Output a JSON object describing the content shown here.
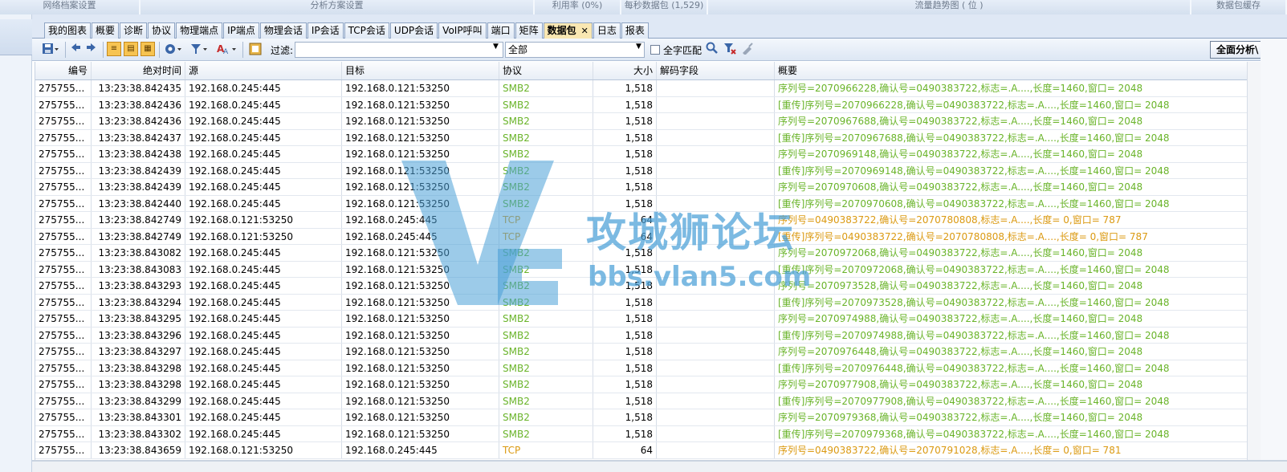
{
  "top_headers": [
    {
      "label": "网络档案设置"
    },
    {
      "label": "分析方案设置"
    },
    {
      "label": "利用率 (0%)"
    },
    {
      "label": "每秒数据包 (1,529)"
    },
    {
      "label": "流量趋势图 ( 位 )"
    },
    {
      "label": "数据包缓存"
    }
  ],
  "tabs": [
    {
      "label": "我的图表"
    },
    {
      "label": "概要"
    },
    {
      "label": "诊断"
    },
    {
      "label": "协议"
    },
    {
      "label": "物理端点"
    },
    {
      "label": "IP端点"
    },
    {
      "label": "物理会话"
    },
    {
      "label": "IP会话"
    },
    {
      "label": "TCP会话"
    },
    {
      "label": "UDP会话"
    },
    {
      "label": "VoIP呼叫"
    },
    {
      "label": "端口"
    },
    {
      "label": "矩阵"
    },
    {
      "label": "数据包",
      "active": true
    },
    {
      "label": "日志"
    },
    {
      "label": "报表"
    }
  ],
  "active_tab_close": "✕",
  "toolbar": {
    "filter_label": "过滤:",
    "filter_value": "",
    "scope_value": "全部",
    "full_match_label": "全字匹配",
    "full_match_checked": false,
    "full_analysis_label": "全面分析\\"
  },
  "table": {
    "columns": [
      "编号",
      "绝对时间",
      "源",
      "目标",
      "协议",
      "大小",
      "解码字段",
      "概要"
    ],
    "rows": [
      [
        "275755...",
        "13:23:38.842435",
        "192.168.0.245:445",
        "192.168.0.121:53250",
        "SMB2",
        "1,518",
        "",
        "序列号=2070966228,确认号=0490383722,标志=.A....,长度=1460,窗口= 2048"
      ],
      [
        "275755...",
        "13:23:38.842436",
        "192.168.0.245:445",
        "192.168.0.121:53250",
        "SMB2",
        "1,518",
        "",
        "[重传]序列号=2070966228,确认号=0490383722,标志=.A....,长度=1460,窗口= 2048"
      ],
      [
        "275755...",
        "13:23:38.842436",
        "192.168.0.245:445",
        "192.168.0.121:53250",
        "SMB2",
        "1,518",
        "",
        "序列号=2070967688,确认号=0490383722,标志=.A....,长度=1460,窗口= 2048"
      ],
      [
        "275755...",
        "13:23:38.842437",
        "192.168.0.245:445",
        "192.168.0.121:53250",
        "SMB2",
        "1,518",
        "",
        "[重传]序列号=2070967688,确认号=0490383722,标志=.A....,长度=1460,窗口= 2048"
      ],
      [
        "275755...",
        "13:23:38.842438",
        "192.168.0.245:445",
        "192.168.0.121:53250",
        "SMB2",
        "1,518",
        "",
        "序列号=2070969148,确认号=0490383722,标志=.A....,长度=1460,窗口= 2048"
      ],
      [
        "275755...",
        "13:23:38.842439",
        "192.168.0.245:445",
        "192.168.0.121:53250",
        "SMB2",
        "1,518",
        "",
        "[重传]序列号=2070969148,确认号=0490383722,标志=.A....,长度=1460,窗口= 2048"
      ],
      [
        "275755...",
        "13:23:38.842439",
        "192.168.0.245:445",
        "192.168.0.121:53250",
        "SMB2",
        "1,518",
        "",
        "序列号=2070970608,确认号=0490383722,标志=.A....,长度=1460,窗口= 2048"
      ],
      [
        "275755...",
        "13:23:38.842440",
        "192.168.0.245:445",
        "192.168.0.121:53250",
        "SMB2",
        "1,518",
        "",
        "[重传]序列号=2070970608,确认号=0490383722,标志=.A....,长度=1460,窗口= 2048"
      ],
      [
        "275755...",
        "13:23:38.842749",
        "192.168.0.121:53250",
        "192.168.0.245:445",
        "TCP",
        "64",
        "",
        "序列号=0490383722,确认号=2070780808,标志=.A....,长度=    0,窗口=  787"
      ],
      [
        "275755...",
        "13:23:38.842749",
        "192.168.0.121:53250",
        "192.168.0.245:445",
        "TCP",
        "64",
        "",
        "[重传]序列号=0490383722,确认号=2070780808,标志=.A....,长度=    0,窗口=  787"
      ],
      [
        "275755...",
        "13:23:38.843082",
        "192.168.0.245:445",
        "192.168.0.121:53250",
        "SMB2",
        "1,518",
        "",
        "序列号=2070972068,确认号=0490383722,标志=.A....,长度=1460,窗口= 2048"
      ],
      [
        "275755...",
        "13:23:38.843083",
        "192.168.0.245:445",
        "192.168.0.121:53250",
        "SMB2",
        "1,518",
        "",
        "[重传]序列号=2070972068,确认号=0490383722,标志=.A....,长度=1460,窗口= 2048"
      ],
      [
        "275755...",
        "13:23:38.843293",
        "192.168.0.245:445",
        "192.168.0.121:53250",
        "SMB2",
        "1,518",
        "",
        "序列号=2070973528,确认号=0490383722,标志=.A....,长度=1460,窗口= 2048"
      ],
      [
        "275755...",
        "13:23:38.843294",
        "192.168.0.245:445",
        "192.168.0.121:53250",
        "SMB2",
        "1,518",
        "",
        "[重传]序列号=2070973528,确认号=0490383722,标志=.A....,长度=1460,窗口= 2048"
      ],
      [
        "275755...",
        "13:23:38.843295",
        "192.168.0.245:445",
        "192.168.0.121:53250",
        "SMB2",
        "1,518",
        "",
        "序列号=2070974988,确认号=0490383722,标志=.A....,长度=1460,窗口= 2048"
      ],
      [
        "275755...",
        "13:23:38.843296",
        "192.168.0.245:445",
        "192.168.0.121:53250",
        "SMB2",
        "1,518",
        "",
        "[重传]序列号=2070974988,确认号=0490383722,标志=.A....,长度=1460,窗口= 2048"
      ],
      [
        "275755...",
        "13:23:38.843297",
        "192.168.0.245:445",
        "192.168.0.121:53250",
        "SMB2",
        "1,518",
        "",
        "序列号=2070976448,确认号=0490383722,标志=.A....,长度=1460,窗口= 2048"
      ],
      [
        "275755...",
        "13:23:38.843298",
        "192.168.0.245:445",
        "192.168.0.121:53250",
        "SMB2",
        "1,518",
        "",
        "[重传]序列号=2070976448,确认号=0490383722,标志=.A....,长度=1460,窗口= 2048"
      ],
      [
        "275755...",
        "13:23:38.843298",
        "192.168.0.245:445",
        "192.168.0.121:53250",
        "SMB2",
        "1,518",
        "",
        "序列号=2070977908,确认号=0490383722,标志=.A....,长度=1460,窗口= 2048"
      ],
      [
        "275755...",
        "13:23:38.843299",
        "192.168.0.245:445",
        "192.168.0.121:53250",
        "SMB2",
        "1,518",
        "",
        "[重传]序列号=2070977908,确认号=0490383722,标志=.A....,长度=1460,窗口= 2048"
      ],
      [
        "275755...",
        "13:23:38.843301",
        "192.168.0.245:445",
        "192.168.0.121:53250",
        "SMB2",
        "1,518",
        "",
        "序列号=2070979368,确认号=0490383722,标志=.A....,长度=1460,窗口= 2048"
      ],
      [
        "275755...",
        "13:23:38.843302",
        "192.168.0.245:445",
        "192.168.0.121:53250",
        "SMB2",
        "1,518",
        "",
        "[重传]序列号=2070979368,确认号=0490383722,标志=.A....,长度=1460,窗口= 2048"
      ],
      [
        "275755...",
        "13:23:38.843659",
        "192.168.0.121:53250",
        "192.168.0.245:445",
        "TCP",
        "64",
        "",
        "序列号=0490383722,确认号=2070791028,标志=.A....,长度=    0,窗口=  781"
      ]
    ]
  },
  "colors": {
    "smb2": "#6ab42a",
    "tcp": "#db9a12",
    "active_tab": "#f9e7b2"
  },
  "watermark": {
    "title": "攻城狮论坛",
    "url": "bbs.vlan5.com"
  }
}
